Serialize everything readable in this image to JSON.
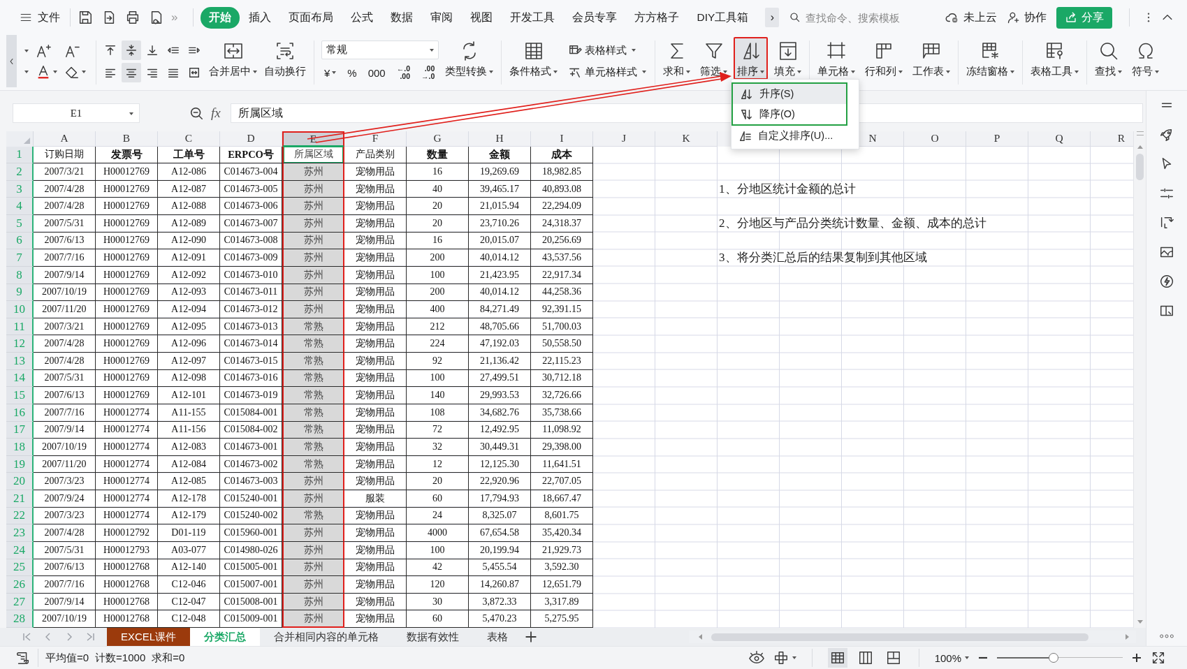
{
  "menu_bar": {
    "file_menu": "文件",
    "more_tools": "»",
    "tabs": [
      {
        "label": "开始",
        "selected": true
      },
      {
        "label": "插入",
        "selected": false
      },
      {
        "label": "页面布局",
        "selected": false
      },
      {
        "label": "公式",
        "selected": false
      },
      {
        "label": "数据",
        "selected": false
      },
      {
        "label": "审阅",
        "selected": false
      },
      {
        "label": "视图",
        "selected": false
      },
      {
        "label": "开发工具",
        "selected": false
      },
      {
        "label": "会员专享",
        "selected": false
      },
      {
        "label": "方方格子",
        "selected": false
      },
      {
        "label": "DIY工具箱",
        "selected": false
      }
    ],
    "tabs_scroll": "›",
    "search": {
      "placeholder": "查找命令、搜索模板"
    },
    "cloud_status": "未上云",
    "collaborate": "协作",
    "share": "分享"
  },
  "ribbon": {
    "alignment_buttons": [
      {
        "selected": false
      },
      {
        "selected": true
      },
      {
        "selected": false
      },
      {
        "selected": false
      },
      {
        "selected": false
      },
      {
        "selected": false
      },
      {
        "selected": true
      },
      {
        "selected": false
      },
      {
        "selected": false
      },
      {
        "selected": false
      }
    ],
    "merge_buttons": [
      {
        "label": "合并居中",
        "dropdown": true
      },
      {
        "label": "自动换行",
        "dropdown": false
      }
    ],
    "number_format": {
      "value": "常规"
    },
    "number_buttons": [
      {
        "lines": [
          "¥"
        ],
        "dropdown": true
      },
      {
        "lines": [
          "%"
        ],
        "dropdown": false
      },
      {
        "lines": [
          "000"
        ],
        "dropdown": false
      },
      {
        "lines": [
          "←.0",
          ".00"
        ],
        "dropdown": false
      },
      {
        "lines": [
          ".00",
          "→.0"
        ],
        "dropdown": false
      }
    ],
    "convert_button": {
      "label": "类型转换",
      "dropdown": true
    },
    "groups": [
      [
        {
          "kind": "big",
          "label": "条件格式",
          "dropdown": true,
          "selected": false,
          "highlighted": false
        },
        {
          "kind": "small",
          "label": "表格样式",
          "dropdown": true,
          "selected": false,
          "highlighted": false
        },
        {
          "kind": "small",
          "label": "单元格样式",
          "dropdown": true,
          "selected": false,
          "highlighted": false
        }
      ],
      [
        {
          "kind": "big",
          "label": "求和",
          "dropdown": true,
          "selected": false,
          "highlighted": false
        },
        {
          "kind": "big",
          "label": "筛选",
          "dropdown": true,
          "selected": false,
          "highlighted": false
        },
        {
          "kind": "big",
          "label": "排序",
          "dropdown": true,
          "selected": true,
          "highlighted": true
        },
        {
          "kind": "big",
          "label": "填充",
          "dropdown": true,
          "selected": false,
          "highlighted": false
        }
      ],
      [
        {
          "kind": "big",
          "label": "单元格",
          "dropdown": true,
          "selected": false,
          "highlighted": false
        },
        {
          "kind": "big",
          "label": "行和列",
          "dropdown": true,
          "selected": false,
          "highlighted": false
        },
        {
          "kind": "big",
          "label": "工作表",
          "dropdown": true,
          "selected": false,
          "highlighted": false
        }
      ],
      [
        {
          "kind": "big",
          "label": "冻结窗格",
          "dropdown": true,
          "selected": false,
          "highlighted": false
        }
      ],
      [
        {
          "kind": "big",
          "label": "表格工具",
          "dropdown": true,
          "selected": false,
          "highlighted": false
        }
      ],
      [
        {
          "kind": "big",
          "label": "查找",
          "dropdown": true,
          "selected": false,
          "highlighted": false
        },
        {
          "kind": "big",
          "label": "符号",
          "dropdown": true,
          "selected": false,
          "highlighted": false
        }
      ]
    ]
  },
  "sort_menu": {
    "items": [
      {
        "label": "升序(S)",
        "selected": true,
        "framed": true
      },
      {
        "label": "降序(O)",
        "selected": false,
        "framed": true
      },
      {
        "label": "自定义排序(U)...",
        "selected": false,
        "framed": false
      }
    ]
  },
  "formula_bar": {
    "name_box": "E1",
    "function_label": "fx",
    "formula": "所属区域"
  },
  "sheet": {
    "columns": [
      {
        "label": "A",
        "selected": false
      },
      {
        "label": "B",
        "selected": false
      },
      {
        "label": "C",
        "selected": false
      },
      {
        "label": "D",
        "selected": false
      },
      {
        "label": "E",
        "selected": true
      },
      {
        "label": "F",
        "selected": false
      },
      {
        "label": "G",
        "selected": false
      },
      {
        "label": "H",
        "selected": false
      },
      {
        "label": "I",
        "selected": false
      },
      {
        "label": "J",
        "selected": false
      },
      {
        "label": "K",
        "selected": false
      },
      {},
      {},
      {
        "label": "N",
        "selected": false
      },
      {
        "label": "O",
        "selected": false
      },
      {
        "label": "P",
        "selected": false
      },
      {
        "label": "Q",
        "selected": false
      },
      {
        "label": "R",
        "selected": false
      }
    ],
    "header_row": {
      "number": "1",
      "cells": [
        {
          "text": "订购日期",
          "bold": false,
          "active": false
        },
        {
          "text": "发票号",
          "bold": true,
          "active": false
        },
        {
          "text": "工单号",
          "bold": true,
          "active": false
        },
        {
          "text": "ERPCO号",
          "bold": true,
          "active": false
        },
        {
          "text": "所属区域",
          "bold": false,
          "active": true
        },
        {
          "text": "产品类别",
          "bold": false,
          "active": false
        },
        {
          "text": "数量",
          "bold": true,
          "active": false
        },
        {
          "text": "金额",
          "bold": true,
          "active": false
        },
        {
          "text": "成本",
          "bold": true,
          "active": false
        }
      ]
    },
    "rows": [
      {
        "number": "2",
        "cells": [
          "2007/3/21",
          "H00012769",
          "A12-086",
          "C014673-004",
          "苏州",
          "宠物用品",
          "16",
          "19,269.69",
          "18,982.85"
        ]
      },
      {
        "number": "3",
        "cells": [
          "2007/4/28",
          "H00012769",
          "A12-087",
          "C014673-005",
          "苏州",
          "宠物用品",
          "40",
          "39,465.17",
          "40,893.08"
        ],
        "note": "1、分地区统计金额的总计"
      },
      {
        "number": "4",
        "cells": [
          "2007/4/28",
          "H00012769",
          "A12-088",
          "C014673-006",
          "苏州",
          "宠物用品",
          "20",
          "21,015.94",
          "22,294.09"
        ]
      },
      {
        "number": "5",
        "cells": [
          "2007/5/31",
          "H00012769",
          "A12-089",
          "C014673-007",
          "苏州",
          "宠物用品",
          "20",
          "23,710.26",
          "24,318.37"
        ],
        "note": "2、分地区与产品分类统计数量、金额、成本的总计"
      },
      {
        "number": "6",
        "cells": [
          "2007/6/13",
          "H00012769",
          "A12-090",
          "C014673-008",
          "苏州",
          "宠物用品",
          "16",
          "20,015.07",
          "20,256.69"
        ]
      },
      {
        "number": "7",
        "cells": [
          "2007/7/16",
          "H00012769",
          "A12-091",
          "C014673-009",
          "苏州",
          "宠物用品",
          "200",
          "40,014.12",
          "43,537.56"
        ],
        "note": "3、将分类汇总后的结果复制到其他区域"
      },
      {
        "number": "8",
        "cells": [
          "2007/9/14",
          "H00012769",
          "A12-092",
          "C014673-010",
          "苏州",
          "宠物用品",
          "100",
          "21,423.95",
          "22,917.34"
        ]
      },
      {
        "number": "9",
        "cells": [
          "2007/10/19",
          "H00012769",
          "A12-093",
          "C014673-011",
          "苏州",
          "宠物用品",
          "200",
          "40,014.12",
          "44,258.36"
        ]
      },
      {
        "number": "10",
        "cells": [
          "2007/11/20",
          "H00012769",
          "A12-094",
          "C014673-012",
          "苏州",
          "宠物用品",
          "400",
          "84,271.49",
          "92,391.15"
        ]
      },
      {
        "number": "11",
        "cells": [
          "2007/3/21",
          "H00012769",
          "A12-095",
          "C014673-013",
          "常熟",
          "宠物用品",
          "212",
          "48,705.66",
          "51,700.03"
        ]
      },
      {
        "number": "12",
        "cells": [
          "2007/4/28",
          "H00012769",
          "A12-096",
          "C014673-014",
          "常熟",
          "宠物用品",
          "224",
          "47,192.03",
          "50,558.50"
        ]
      },
      {
        "number": "13",
        "cells": [
          "2007/4/28",
          "H00012769",
          "A12-097",
          "C014673-015",
          "常熟",
          "宠物用品",
          "92",
          "21,136.42",
          "22,115.23"
        ]
      },
      {
        "number": "14",
        "cells": [
          "2007/5/31",
          "H00012769",
          "A12-098",
          "C014673-016",
          "常熟",
          "宠物用品",
          "100",
          "27,499.51",
          "30,712.18"
        ]
      },
      {
        "number": "15",
        "cells": [
          "2007/6/13",
          "H00012769",
          "A12-101",
          "C014673-019",
          "常熟",
          "宠物用品",
          "140",
          "29,993.53",
          "32,726.66"
        ]
      },
      {
        "number": "16",
        "cells": [
          "2007/7/16",
          "H00012774",
          "A11-155",
          "C015084-001",
          "常熟",
          "宠物用品",
          "108",
          "34,682.76",
          "35,738.66"
        ]
      },
      {
        "number": "17",
        "cells": [
          "2007/9/14",
          "H00012774",
          "A11-156",
          "C015084-002",
          "常熟",
          "宠物用品",
          "72",
          "12,492.95",
          "11,098.92"
        ]
      },
      {
        "number": "18",
        "cells": [
          "2007/10/19",
          "H00012774",
          "A12-083",
          "C014673-001",
          "常熟",
          "宠物用品",
          "32",
          "30,449.31",
          "29,398.00"
        ]
      },
      {
        "number": "19",
        "cells": [
          "2007/11/20",
          "H00012774",
          "A12-084",
          "C014673-002",
          "常熟",
          "宠物用品",
          "12",
          "12,125.30",
          "11,641.51"
        ]
      },
      {
        "number": "20",
        "cells": [
          "2007/3/23",
          "H00012774",
          "A12-085",
          "C014673-003",
          "苏州",
          "宠物用品",
          "20",
          "22,920.96",
          "22,707.05"
        ]
      },
      {
        "number": "21",
        "cells": [
          "2007/9/24",
          "H00012774",
          "A12-178",
          "C015240-001",
          "苏州",
          "服装",
          "60",
          "17,794.93",
          "18,667.47"
        ]
      },
      {
        "number": "22",
        "cells": [
          "2007/3/23",
          "H00012774",
          "A12-179",
          "C015240-002",
          "常熟",
          "宠物用品",
          "24",
          "8,325.07",
          "8,601.75"
        ]
      },
      {
        "number": "23",
        "cells": [
          "2007/4/28",
          "H00012792",
          "D01-119",
          "C015960-001",
          "苏州",
          "宠物用品",
          "4000",
          "67,654.58",
          "35,420.34"
        ]
      },
      {
        "number": "24",
        "cells": [
          "2007/5/31",
          "H00012793",
          "A03-077",
          "C014980-026",
          "苏州",
          "宠物用品",
          "100",
          "20,199.94",
          "21,929.73"
        ]
      },
      {
        "number": "25",
        "cells": [
          "2007/6/13",
          "H00012768",
          "A12-140",
          "C015005-001",
          "苏州",
          "宠物用品",
          "42",
          "5,455.54",
          "3,592.30"
        ]
      },
      {
        "number": "26",
        "cells": [
          "2007/7/16",
          "H00012768",
          "C12-046",
          "C015007-001",
          "苏州",
          "宠物用品",
          "120",
          "14,260.87",
          "12,651.79"
        ]
      },
      {
        "number": "27",
        "cells": [
          "2007/9/14",
          "H00012768",
          "C12-047",
          "C015008-001",
          "苏州",
          "宠物用品",
          "30",
          "3,872.33",
          "3,317.89"
        ]
      },
      {
        "number": "28",
        "cells": [
          "2007/10/19",
          "H00012768",
          "C12-048",
          "C015009-001",
          "苏州",
          "宠物用品",
          "60",
          "5,470.23",
          "5,275.95"
        ]
      }
    ]
  },
  "sheet_tabs": [
    {
      "label": "EXCEL课件",
      "selected": false,
      "color": "#9b3a0c"
    },
    {
      "label": "分类汇总",
      "selected": true
    },
    {
      "label": "合并相同内容的单元格",
      "selected": false
    },
    {
      "label": "数据有效性",
      "selected": false
    },
    {
      "label": "表格",
      "selected": false
    }
  ],
  "status_bar": {
    "stats": [
      "平均值=0",
      "计数=1000",
      "求和=0"
    ],
    "view_buttons": [
      {
        "selected": true
      },
      {
        "selected": false
      },
      {
        "selected": false
      }
    ],
    "zoom": "100%",
    "zoom_slider": {
      "level": 0.45
    }
  }
}
